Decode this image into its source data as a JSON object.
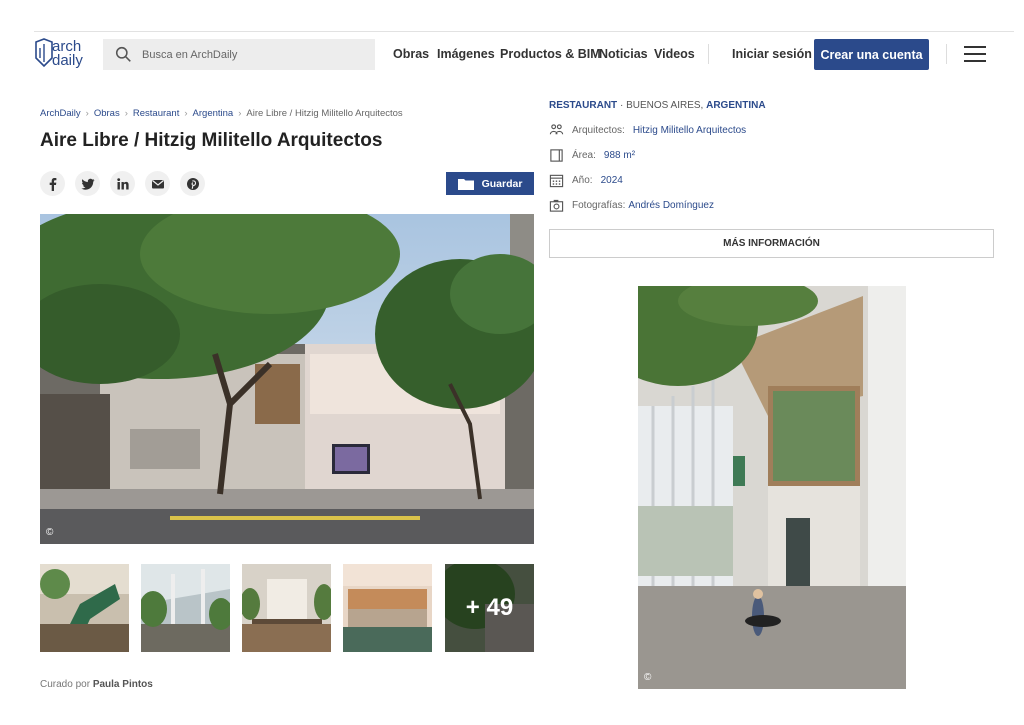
{
  "header": {
    "logo_text": "arch daily",
    "search_placeholder": "Busca en ArchDaily",
    "nav": [
      "Obras",
      "Imágenes",
      "Productos & BIM",
      "Noticias",
      "Videos"
    ],
    "login": "Iniciar sesión",
    "create_account": "Crear una cuenta"
  },
  "breadcrumb": [
    "ArchDaily",
    "Obras",
    "Restaurant",
    "Argentina",
    "Aire Libre / Hitzig Militello Arquitectos"
  ],
  "title": "Aire Libre / Hitzig Militello Arquitectos",
  "save_label": "Guardar",
  "share_icons": [
    "facebook-icon",
    "twitter-icon",
    "linkedin-icon",
    "email-icon",
    "pinterest-icon"
  ],
  "gallery": {
    "more_count": "+ 49",
    "copyright": "©"
  },
  "curated": {
    "prefix": "Curado por",
    "name": "Paula Pintos"
  },
  "project": {
    "category": "RESTAURANT",
    "city": "BUENOS AIRES,",
    "country": "ARGENTINA",
    "architects_label": "Arquitectos:",
    "architects_value": "Hitzig Militello Arquitectos",
    "area_label": "Área:",
    "area_value": "988 m²",
    "year_label": "Año:",
    "year_value": "2024",
    "photos_label": "Fotografías:",
    "photos_value": "Andrés Domínguez",
    "more_info": "MÁS INFORMACIÓN"
  },
  "colors": {
    "brand_blue": "#2b4a8b"
  }
}
